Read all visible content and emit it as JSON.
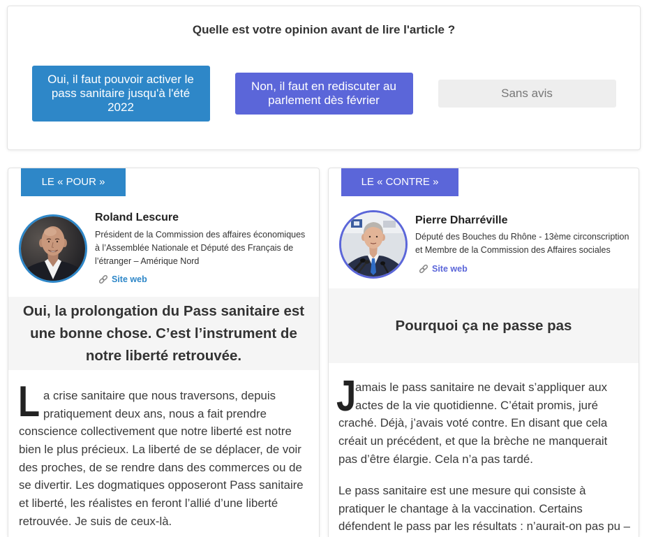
{
  "theme": {
    "pour_color": "#2e87c8",
    "contre_color": "#5b66d9",
    "neutral_color": "#eeeeee"
  },
  "poll": {
    "question": "Quelle est votre opinion avant de lire l'article ?",
    "options": [
      {
        "label": "Oui, il faut pouvoir activer le pass sanitaire jusqu'à l'été 2022",
        "color": "#2e87c8"
      },
      {
        "label": "Non, il faut en rediscuter au parlement dès février",
        "color": "#5b66d9"
      },
      {
        "label": "Sans avis",
        "color": "#eeeeee"
      }
    ]
  },
  "columns": [
    {
      "tag": "LE « POUR »",
      "author": {
        "name": "Roland Lescure",
        "description": [
          "Président de la Commission des affaires économiques",
          "à l’Assemblée Nationale et Député des Français de",
          "l’étranger – Amérique Nord"
        ],
        "link": {
          "icon": "link-icon",
          "label": "Site web"
        }
      },
      "headline": [
        "Oui, la prolongation du Pass sanitaire est",
        "une bonne chose. C’est l’instrument de",
        "notre liberté retrouvée."
      ],
      "paragraphs": [
        {
          "drop_cap": "L",
          "lines": [
            "a crise sanitaire que nous traversons, depuis",
            "pratiquement deux ans, nous a fait prendre",
            "conscience collectivement que notre liberté est notre",
            "bien le plus précieux. La liberté de se déplacer, de voir",
            "des proches, de se rendre dans des commerces ou de",
            "se divertir. Les dogmatiques opposeront Pass sanitaire",
            "et liberté, les réalistes en feront l’allié d’une liberté",
            "retrouvée. Je suis de ceux-là."
          ]
        }
      ]
    },
    {
      "tag": "LE « CONTRE »",
      "author": {
        "name": "Pierre Dharréville",
        "description": [
          "Député des Bouches du Rhône - 13ème circonscription",
          "et Membre de la Commission des Affaires sociales"
        ],
        "link": {
          "icon": "link-icon",
          "label": "Site web"
        }
      },
      "headline": [
        "Pourquoi ça ne passe pas"
      ],
      "paragraphs": [
        {
          "drop_cap": "J",
          "lines": [
            "amais le pass sanitaire ne devait s’appliquer aux",
            "actes de la vie quotidienne. C’était promis, juré",
            "craché. Déjà, j’avais voté contre. En disant que cela",
            "créait un précédent, et que la brèche ne manquerait",
            "pas d’être élargie. Cela n’a pas tardé."
          ]
        },
        {
          "lines": [
            "Le pass sanitaire est une mesure qui consiste à",
            "pratiquer le chantage à la vaccination. Certains",
            "défendent le pass par les résultats : n’aurait-on pas pu –"
          ]
        }
      ]
    }
  ]
}
